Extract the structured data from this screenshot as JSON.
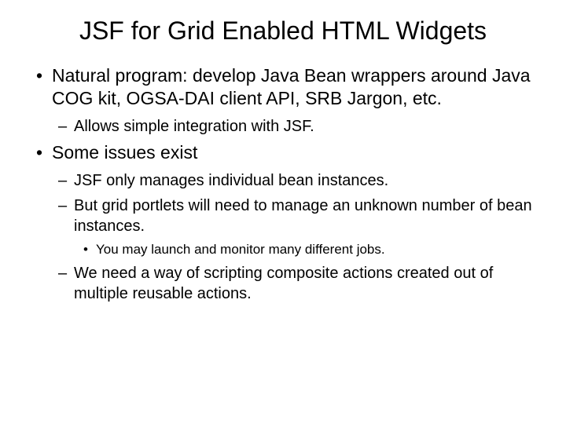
{
  "title": "JSF for Grid Enabled HTML Widgets",
  "bullets": {
    "b1": "Natural program: develop Java Bean wrappers around Java COG kit, OGSA-DAI client API, SRB Jargon, etc.",
    "b1_1": "Allows simple integration with JSF.",
    "b2": "Some issues exist",
    "b2_1": "JSF only manages individual bean instances.",
    "b2_2": "But grid portlets will need to manage an unknown number of bean instances.",
    "b2_2_1": "You may launch and monitor many different jobs.",
    "b2_3": "We need a way of scripting composite actions created out of multiple reusable actions."
  }
}
